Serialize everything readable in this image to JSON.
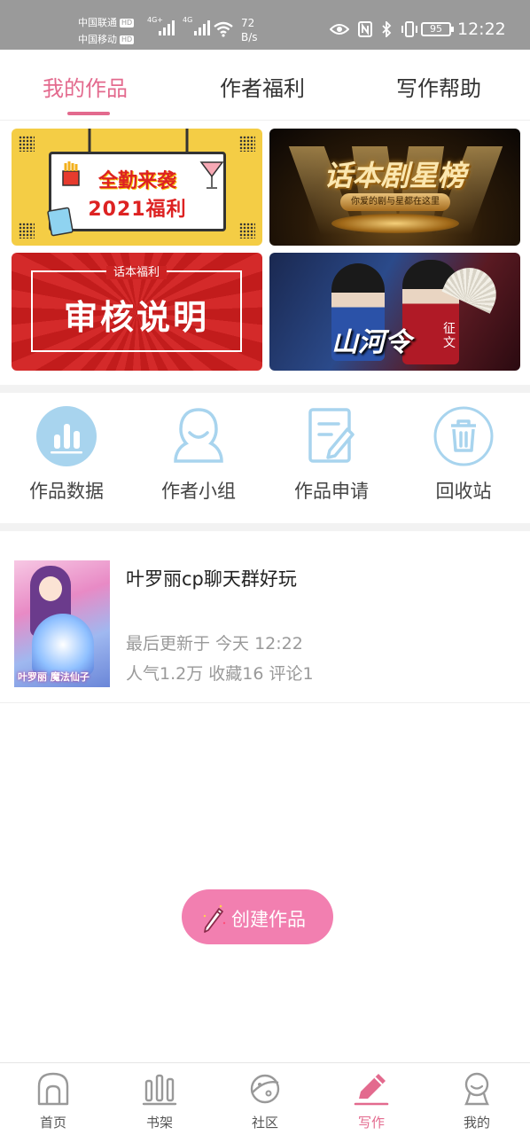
{
  "status_bar": {
    "carrier1": "中国联通",
    "carrier2": "中国移动",
    "hd": "HD",
    "net1": "4G+",
    "net2": "4G",
    "speed_value": "72",
    "speed_unit": "B/s",
    "battery": "95",
    "time": "12:22"
  },
  "tabs": [
    {
      "label": "我的作品",
      "active": true
    },
    {
      "label": "作者福利",
      "active": false
    },
    {
      "label": "写作帮助",
      "active": false
    }
  ],
  "banners": {
    "b1": {
      "line1": "全勤来袭",
      "line2": "2021福利"
    },
    "b2": {
      "title": "话本剧星榜",
      "subtitle": "你爱的剧与星都在这里"
    },
    "b3": {
      "subtitle": "话本福利",
      "title": "审核说明"
    },
    "b4": {
      "title": "山河令",
      "tag": "征文"
    }
  },
  "entries": [
    {
      "label": "作品数据",
      "icon": "bar-chart-icon"
    },
    {
      "label": "作者小组",
      "icon": "group-icon"
    },
    {
      "label": "作品申请",
      "icon": "edit-document-icon"
    },
    {
      "label": "回收站",
      "icon": "trash-icon"
    }
  ],
  "work": {
    "title": "叶罗丽cp聊天群好玩",
    "updated": "最后更新于 今天 12:22",
    "stats": "人气1.2万 收藏16 评论1",
    "cover_text": "叶罗丽 魔法仙子"
  },
  "create_button": {
    "label": "创建作品"
  },
  "bottom_nav": [
    {
      "label": "首页",
      "icon": "home-icon"
    },
    {
      "label": "书架",
      "icon": "bookshelf-icon"
    },
    {
      "label": "社区",
      "icon": "planet-icon"
    },
    {
      "label": "写作",
      "icon": "pen-icon"
    },
    {
      "label": "我的",
      "icon": "profile-icon"
    }
  ],
  "colors": {
    "accent": "#e36a8e",
    "create_button": "#f27fb0",
    "icon_blue": "#a8d4ee"
  }
}
